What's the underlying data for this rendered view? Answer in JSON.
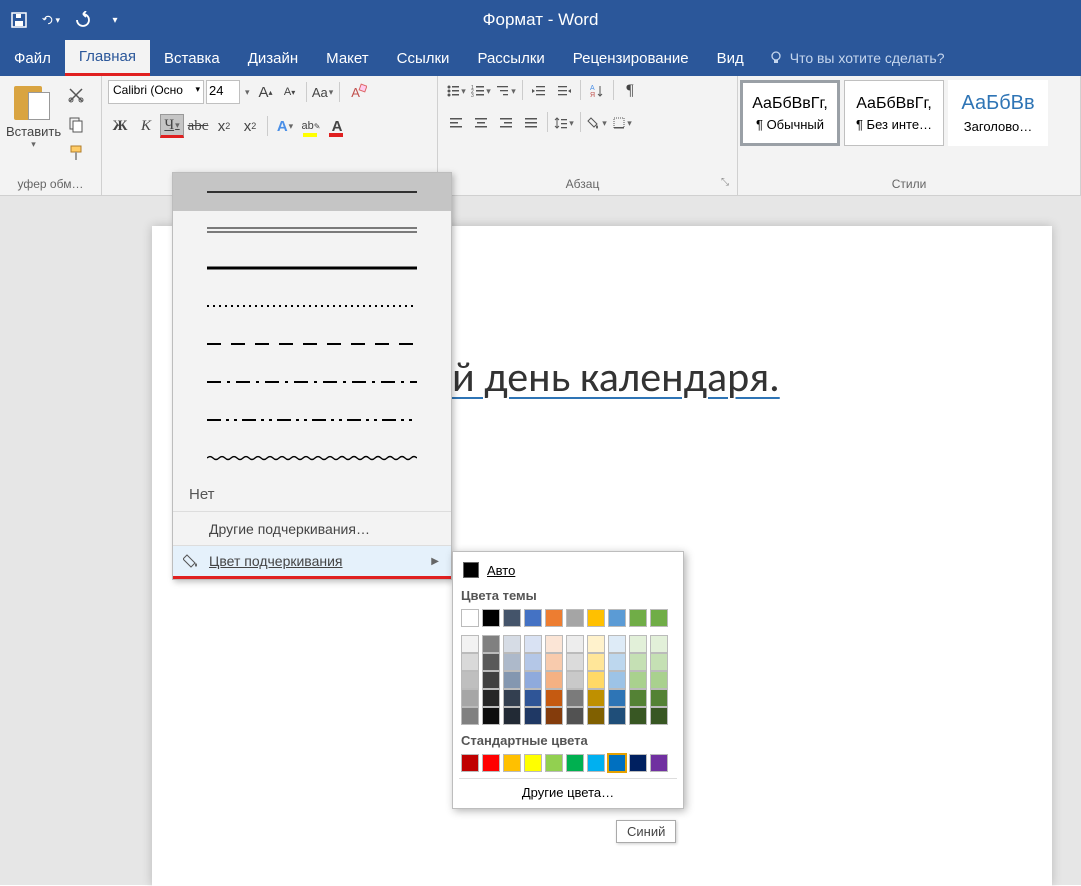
{
  "title": "Формат - Word",
  "tabs": [
    "Файл",
    "Главная",
    "Вставка",
    "Дизайн",
    "Макет",
    "Ссылки",
    "Рассылки",
    "Рецензирование",
    "Вид"
  ],
  "active_tab": 1,
  "tell_me": "Что вы хотите сделать?",
  "clipboard": {
    "paste": "Вставить",
    "label": "уфер обм…"
  },
  "font": {
    "name": "Calibri (Осно",
    "size": "24",
    "buttons": {
      "bold": "Ж",
      "italic": "К",
      "underline": "Ч",
      "strike": "abc",
      "sub": "x",
      "sup": "x",
      "effects": "A",
      "highlight": "ab",
      "color": "A",
      "growA": "A",
      "shrinkA": "A",
      "caseAa": "Aa",
      "clear": "A"
    }
  },
  "paragraph": {
    "label": "Абзац"
  },
  "styles": {
    "label": "Стили",
    "items": [
      {
        "preview": "АаБбВвГг,",
        "name": "¶ Обычный"
      },
      {
        "preview": "АаБбВвГг,",
        "name": "¶ Без инте…"
      },
      {
        "preview": "АаБбВв",
        "name": "Заголово…"
      }
    ]
  },
  "document_text": "й день календаря.",
  "underline_menu": {
    "none": "Нет",
    "more": "Другие подчеркивания…",
    "color": "Цвет подчеркивания"
  },
  "color_popup": {
    "auto": "Авто",
    "theme_label": "Цвета темы",
    "std_label": "Стандартные цвета",
    "more": "Другие цвета…",
    "theme_row1": [
      "#ffffff",
      "#000000",
      "#44546a",
      "#4472c4",
      "#ed7d31",
      "#a5a5a5",
      "#ffc000",
      "#5b9bd5",
      "#70ad47",
      "#70ad47"
    ],
    "theme_shades": [
      [
        "#f2f2f2",
        "#808080",
        "#d6dce5",
        "#d9e2f3",
        "#fbe5d6",
        "#ededed",
        "#fff2cc",
        "#deebf7",
        "#e2f0d9",
        "#e2f0d9"
      ],
      [
        "#d9d9d9",
        "#595959",
        "#adb9ca",
        "#b4c7e7",
        "#f8cbad",
        "#dbdbdb",
        "#ffe699",
        "#bdd7ee",
        "#c5e0b4",
        "#c5e0b4"
      ],
      [
        "#bfbfbf",
        "#404040",
        "#8497b0",
        "#8faadc",
        "#f4b183",
        "#c9c9c9",
        "#ffd966",
        "#9dc3e6",
        "#a9d18e",
        "#a9d18e"
      ],
      [
        "#a6a6a6",
        "#262626",
        "#333f50",
        "#2f5597",
        "#c55a11",
        "#7b7b7b",
        "#bf9000",
        "#2e75b6",
        "#548235",
        "#548235"
      ],
      [
        "#808080",
        "#0d0d0d",
        "#222a35",
        "#1f3864",
        "#843c0c",
        "#525252",
        "#806000",
        "#1f4e79",
        "#385723",
        "#385723"
      ]
    ],
    "standard": [
      "#c00000",
      "#ff0000",
      "#ffc000",
      "#ffff00",
      "#92d050",
      "#00b050",
      "#00b0f0",
      "#0070c0",
      "#002060",
      "#7030a0"
    ],
    "selected_index": 7,
    "tooltip": "Синий"
  }
}
